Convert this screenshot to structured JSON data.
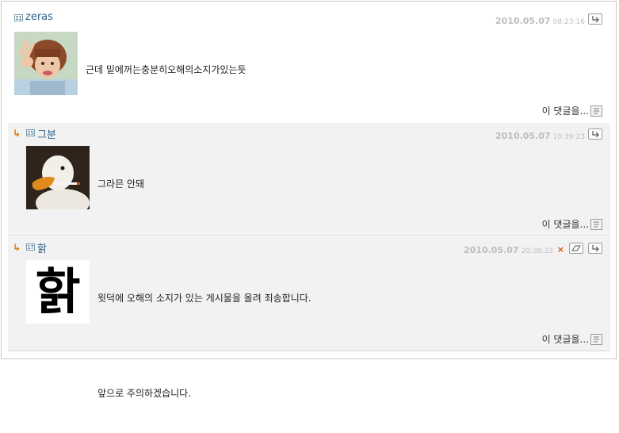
{
  "comments": [
    {
      "nickname": "zeras",
      "level": "II",
      "date": "2010.05.07",
      "time": "08:23:16",
      "lines": [
        "근데 밑에꺼는충분히오해의소지가있는듯"
      ],
      "footer": "이 댓글을..."
    },
    {
      "reply_marker": "↳",
      "nickname": "그분",
      "level": "25",
      "date": "2010.05.07",
      "time": "10:39:23",
      "lines": [
        "그라믄 안돼"
      ],
      "footer": "이 댓글을..."
    },
    {
      "reply_marker": "↳",
      "nickname": "핡",
      "level": "17",
      "date": "2010.05.07",
      "time": "20:38:33",
      "delete_mark": "×",
      "lines": [
        "윗덕에 오해의 소지가 있는 게시물을 올려 죄송합니다.",
        "",
        "앞으로 주의하겠습니다."
      ],
      "avatar_text": "핡",
      "footer": "이 댓글을..."
    }
  ],
  "colors": {
    "nickname": "#2c5f88",
    "reply_arrow": "#e07800",
    "meta": "#bdbdbd",
    "reply_bg": "#f2f2f2"
  },
  "icons": [
    "reply-icon",
    "edit-icon",
    "delete-icon",
    "comment-menu-icon",
    "level-icon"
  ]
}
